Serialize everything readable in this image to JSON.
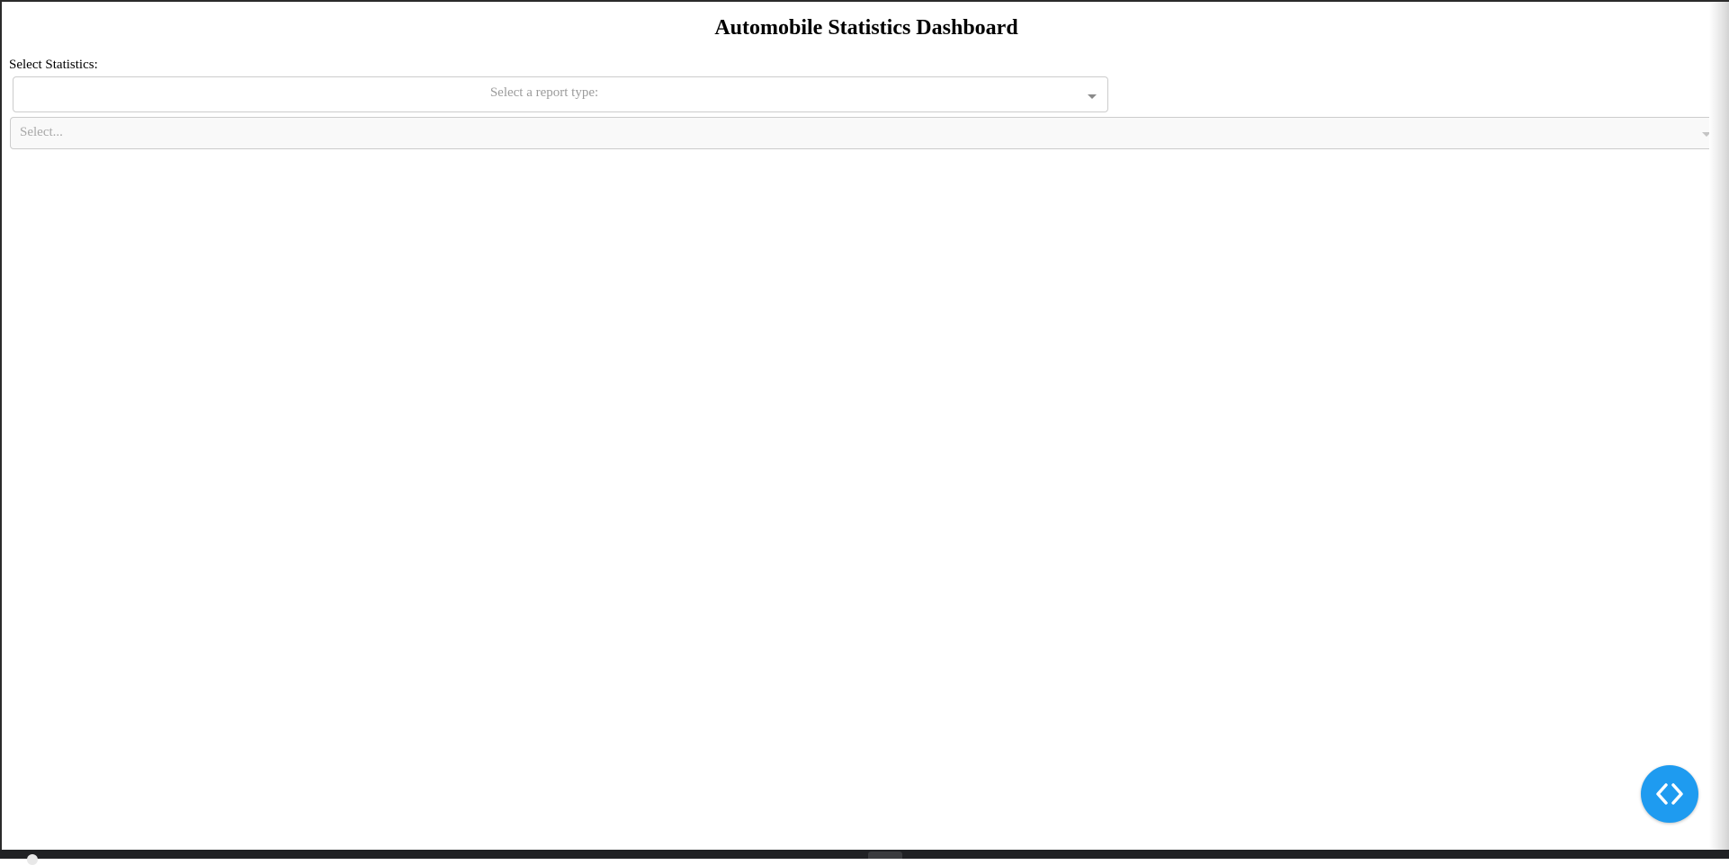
{
  "header": {
    "title": "Automobile Statistics Dashboard"
  },
  "controls": {
    "statistics_label": "Select Statistics:",
    "report_dropdown": {
      "placeholder": "Select a report type:",
      "selected": ""
    },
    "year_dropdown": {
      "placeholder": "Select...",
      "selected": "",
      "disabled": true
    }
  },
  "floating_button": {
    "icon": "code-icon",
    "color": "#1e9bf0"
  },
  "colors": {
    "placeholder_text": "#9b9b9b",
    "border": "#cccccc",
    "disabled_bg": "#f9f9f9"
  }
}
